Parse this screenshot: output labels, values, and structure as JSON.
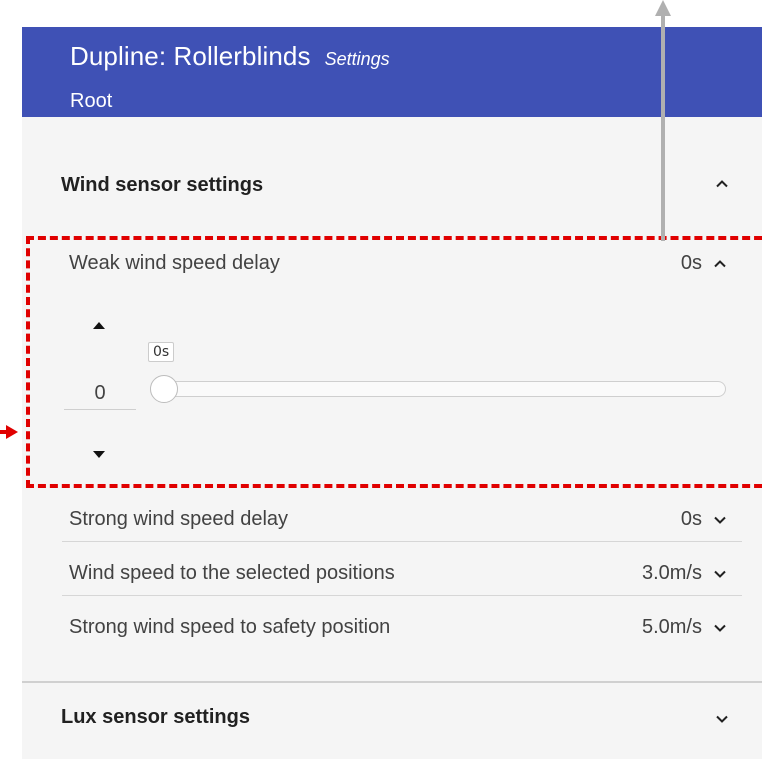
{
  "header": {
    "title": "Dupline: Rollerblinds",
    "subtitle": "Settings",
    "breadcrumb": "Root"
  },
  "wind_section": {
    "title": "Wind sensor settings",
    "expanded": true,
    "chevron_icon": "chevron-up-icon",
    "rows": [
      {
        "label": "Weak wind speed delay",
        "value": "0s",
        "expanded": true,
        "chevron_icon": "chevron-up-icon"
      },
      {
        "label": "Strong wind speed delay",
        "value": "0s",
        "expanded": false,
        "chevron_icon": "chevron-down-icon"
      },
      {
        "label": "Wind speed to the selected positions",
        "value": "3.0m/s",
        "expanded": false,
        "chevron_icon": "chevron-down-icon"
      },
      {
        "label": "Strong wind speed to safety position",
        "value": "5.0m/s",
        "expanded": false,
        "chevron_icon": "chevron-down-icon"
      }
    ]
  },
  "editor": {
    "number_value": "0",
    "slider_tooltip": "0s",
    "slider_level": 0,
    "stepper_up_icon": "arrow-up-icon",
    "stepper_down_icon": "arrow-down-icon"
  },
  "lux_section": {
    "title": "Lux sensor settings",
    "expanded": false,
    "chevron_icon": "chevron-down-icon"
  },
  "colors": {
    "header_bg": "#3f51b5",
    "panel_bg": "#f5f5f5",
    "annotation_red": "#e00000",
    "annotation_gray": "#b0b0b0"
  }
}
